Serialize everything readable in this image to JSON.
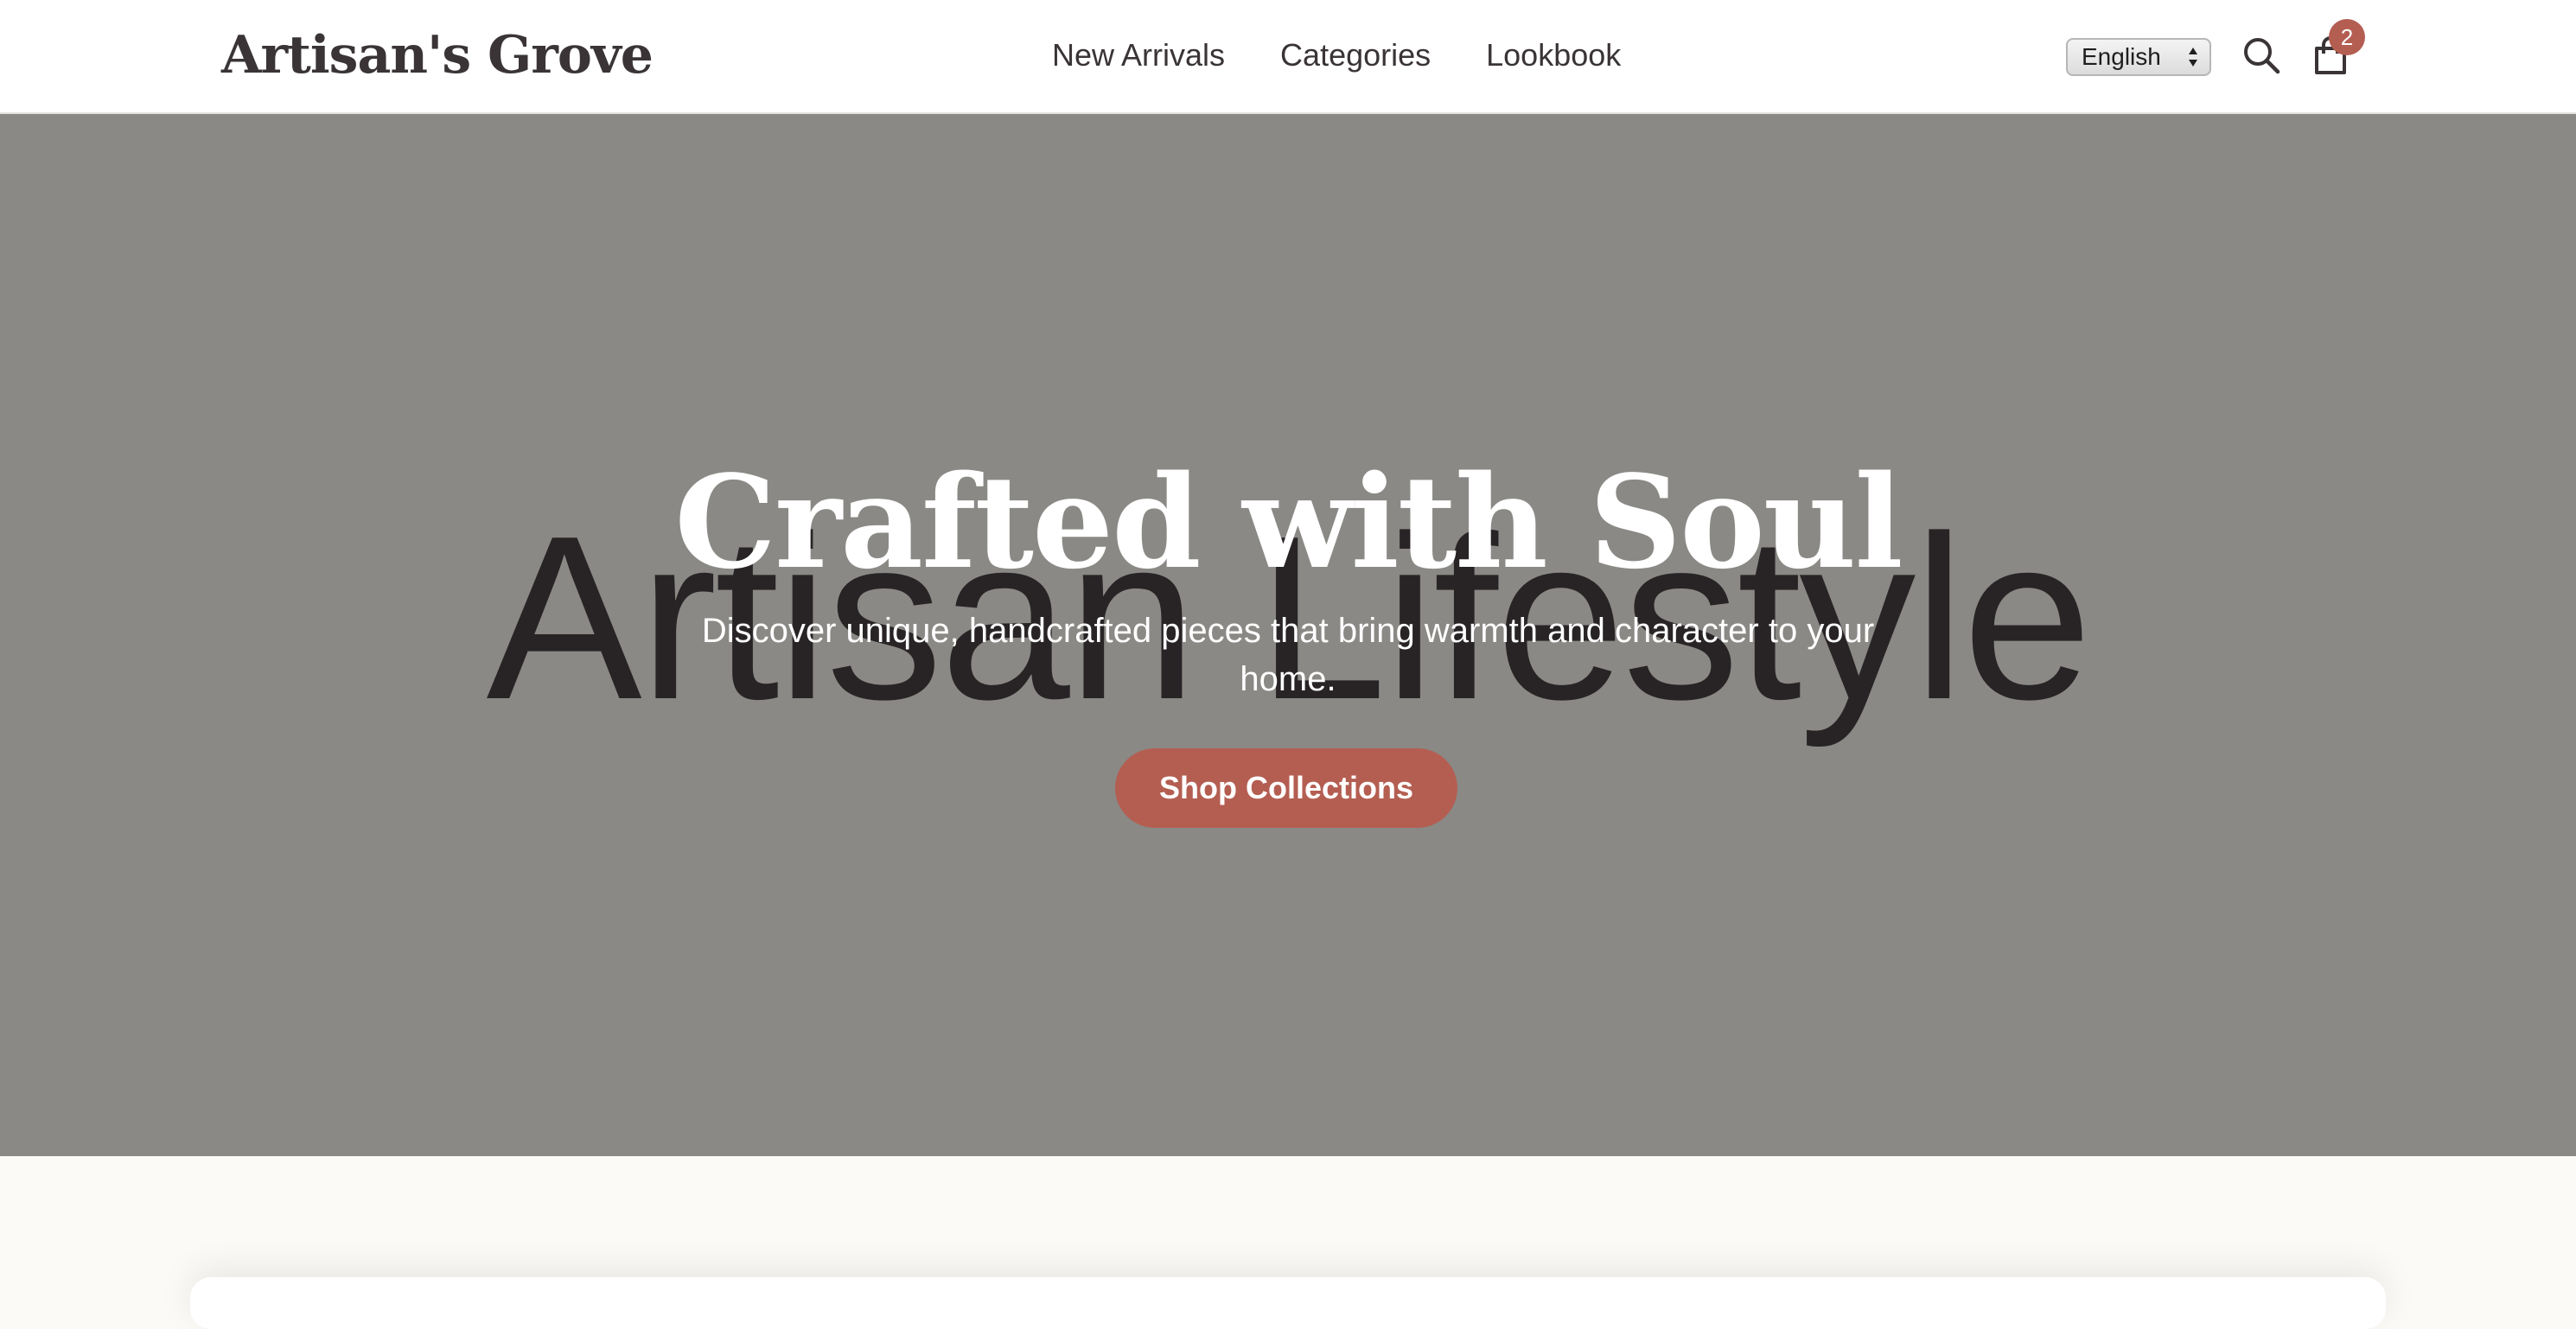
{
  "header": {
    "logo": "Artisan's Grove",
    "nav": [
      "New Arrivals",
      "Categories",
      "Lookbook"
    ],
    "language": "English",
    "cart_count": "2"
  },
  "hero": {
    "background_text": "Artisan Lifestyle",
    "title": "Crafted with Soul",
    "subtitle": "Discover unique, handcrafted pieces that bring warmth and character to your home.",
    "cta_label": "Shop Collections"
  },
  "colors": {
    "accent": "#b45e52",
    "hero_bg": "#8a8985",
    "text_dark": "#3a3436",
    "page_bg": "#fbfaf6"
  },
  "icons": {
    "search": "search-icon",
    "cart": "shopping-bag-icon",
    "select": "select-arrows-icon"
  }
}
